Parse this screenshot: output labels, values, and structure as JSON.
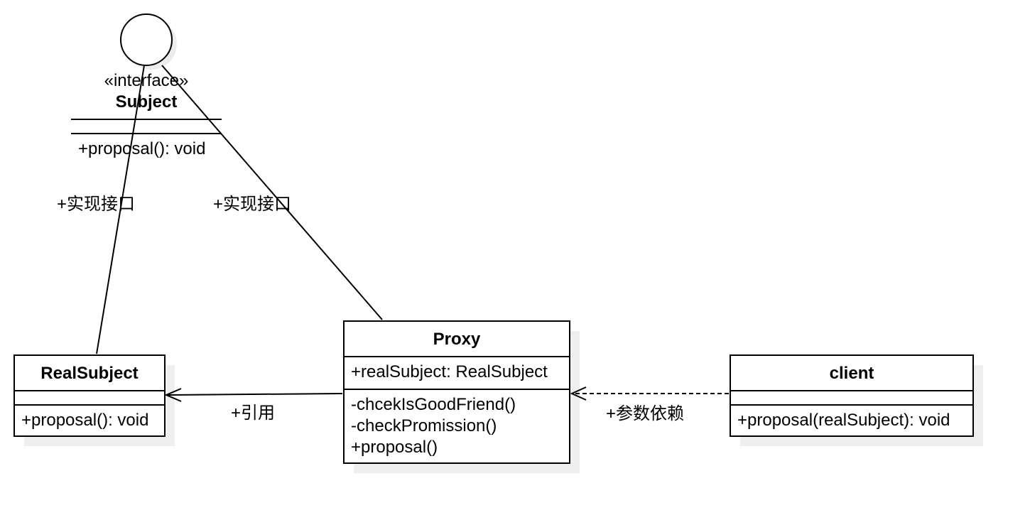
{
  "interface": {
    "stereotype": "«interface»",
    "name": "Subject",
    "methods": [
      "+proposal(): void"
    ]
  },
  "classes": {
    "real_subject": {
      "name": "RealSubject",
      "attributes": [],
      "methods": [
        "+proposal(): void"
      ]
    },
    "proxy": {
      "name": "Proxy",
      "attributes": [
        "+realSubject: RealSubject"
      ],
      "methods": [
        "-chcekIsGoodFriend()",
        "-checkPromission()",
        "+proposal()"
      ]
    },
    "client": {
      "name": "client",
      "attributes": [],
      "methods": [
        "+proposal(realSubject): void"
      ]
    }
  },
  "relations": [
    {
      "from": "RealSubject",
      "to": "Subject",
      "type": "realization",
      "label": "+实现接口"
    },
    {
      "from": "Proxy",
      "to": "Subject",
      "type": "realization",
      "label": "+实现接口"
    },
    {
      "from": "Proxy",
      "to": "RealSubject",
      "type": "association",
      "label": "+引用"
    },
    {
      "from": "client",
      "to": "Proxy",
      "type": "dependency",
      "label": "+参数依赖"
    }
  ]
}
